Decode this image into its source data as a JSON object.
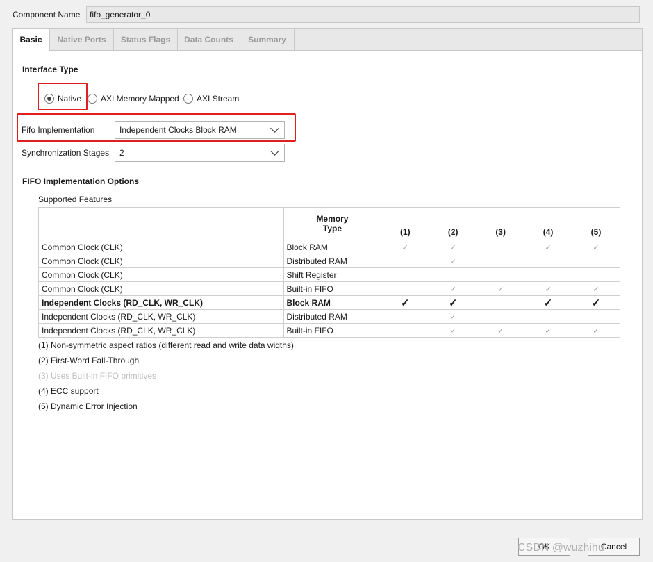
{
  "component": {
    "label": "Component Name",
    "value": "fifo_generator_0"
  },
  "tabs": [
    "Basic",
    "Native Ports",
    "Status Flags",
    "Data Counts",
    "Summary"
  ],
  "interface": {
    "title": "Interface Type",
    "options": [
      "Native",
      "AXI Memory Mapped",
      "AXI Stream"
    ],
    "selected": "Native"
  },
  "fifo_impl": {
    "label": "Fifo Implementation",
    "value": "Independent Clocks Block RAM"
  },
  "sync_stages": {
    "label": "Synchronization Stages",
    "value": "2"
  },
  "options_section": {
    "title": "FIFO Implementation Options",
    "supported_label": "Supported Features",
    "headers": [
      "",
      "Memory\nType",
      "(1)",
      "(2)",
      "(3)",
      "(4)",
      "(5)"
    ],
    "header_memory_line1": "Memory",
    "header_memory_line2": "Type",
    "rows": [
      {
        "clock": "Common Clock (CLK)",
        "memory": "Block RAM",
        "checks": [
          true,
          true,
          false,
          true,
          true
        ],
        "bold": false
      },
      {
        "clock": "Common Clock (CLK)",
        "memory": "Distributed RAM",
        "checks": [
          false,
          true,
          false,
          false,
          false
        ],
        "bold": false
      },
      {
        "clock": "Common Clock (CLK)",
        "memory": "Shift Register",
        "checks": [
          false,
          false,
          false,
          false,
          false
        ],
        "bold": false
      },
      {
        "clock": "Common Clock (CLK)",
        "memory": "Built-in FIFO",
        "checks": [
          false,
          true,
          true,
          true,
          true
        ],
        "bold": false
      },
      {
        "clock": "Independent Clocks (RD_CLK, WR_CLK)",
        "memory": "Block RAM",
        "checks": [
          true,
          true,
          false,
          true,
          true
        ],
        "bold": true
      },
      {
        "clock": "Independent Clocks (RD_CLK, WR_CLK)",
        "memory": "Distributed RAM",
        "checks": [
          false,
          true,
          false,
          false,
          false
        ],
        "bold": false
      },
      {
        "clock": "Independent Clocks (RD_CLK, WR_CLK)",
        "memory": "Built-in FIFO",
        "checks": [
          false,
          true,
          true,
          true,
          true
        ],
        "bold": false
      }
    ],
    "check_glyph": "✓",
    "notes": [
      {
        "text": "(1) Non-symmetric aspect ratios (different read and write data widths)",
        "dim": false
      },
      {
        "text": "(2) First-Word Fall-Through",
        "dim": false
      },
      {
        "text": "(3) Uses Built-in FIFO primitives",
        "dim": true
      },
      {
        "text": "(4) ECC support",
        "dim": false
      },
      {
        "text": "(5) Dynamic Error Injection",
        "dim": false
      }
    ]
  },
  "buttons": {
    "ok": "OK",
    "cancel": "Cancel"
  },
  "watermark": "CSDN @wuzhihu"
}
